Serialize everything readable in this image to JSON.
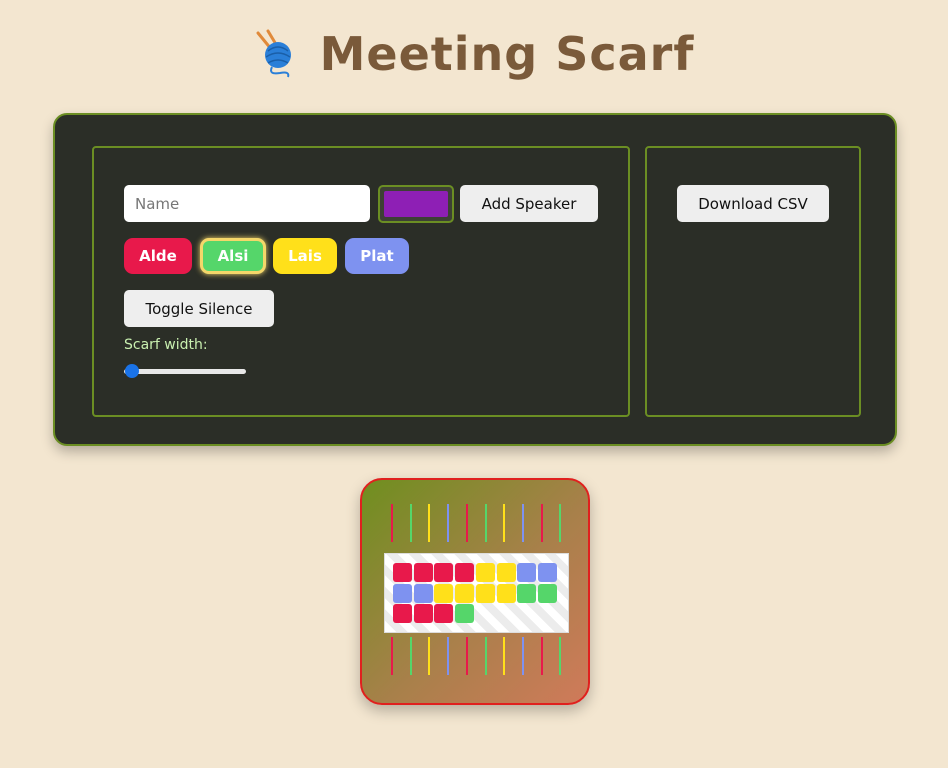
{
  "app": {
    "title": "Meeting Scarf",
    "icon": "yarn-ball-icon"
  },
  "controls": {
    "name_placeholder": "Name",
    "name_value": "",
    "selected_color": "#8e1fb5",
    "add_speaker_label": "Add Speaker",
    "toggle_silence_label": "Toggle Silence",
    "scarf_width_label": "Scarf width:",
    "scarf_width_value": 0,
    "download_csv_label": "Download CSV"
  },
  "speakers": [
    {
      "name": "Alde",
      "color": "#e8194b",
      "active": false
    },
    {
      "name": "Alsi",
      "color": "#55d66a",
      "active": true
    },
    {
      "name": "Lais",
      "color": "#ffe01a",
      "active": false
    },
    {
      "name": "Plat",
      "color": "#7e92f0",
      "active": false
    }
  ],
  "scarf": {
    "fringe_colors": [
      "#e8194b",
      "#55d66a",
      "#ffe01a",
      "#7e92f0",
      "#e8194b",
      "#55d66a",
      "#ffe01a",
      "#7e92f0",
      "#e8194b",
      "#55d66a"
    ],
    "rows": [
      [
        "#e8194b",
        "#e8194b",
        "#e8194b",
        "#e8194b",
        "#ffe01a",
        "#ffe01a",
        "#7e92f0",
        "#7e92f0"
      ],
      [
        "#7e92f0",
        "#7e92f0",
        "#ffe01a",
        "#ffe01a",
        "#ffe01a",
        "#ffe01a",
        "#55d66a",
        "#55d66a"
      ],
      [
        "#e8194b",
        "#e8194b",
        "#e8194b",
        "#55d66a"
      ]
    ]
  }
}
